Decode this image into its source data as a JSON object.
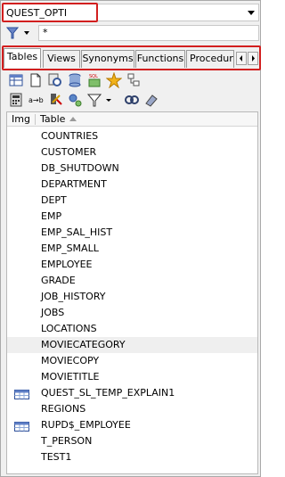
{
  "schema": {
    "value": "QUEST_OPTI"
  },
  "filter": {
    "value": "*"
  },
  "tabs": [
    {
      "label": "Tables",
      "active": true
    },
    {
      "label": "Views"
    },
    {
      "label": "Synonyms"
    },
    {
      "label": "Functions"
    },
    {
      "label": "Procedure"
    }
  ],
  "columns": {
    "img": "Img",
    "table": "Table"
  },
  "rows": [
    {
      "name": "COUNTRIES"
    },
    {
      "name": "CUSTOMER"
    },
    {
      "name": "DB_SHUTDOWN"
    },
    {
      "name": "DEPARTMENT"
    },
    {
      "name": "DEPT"
    },
    {
      "name": "EMP"
    },
    {
      "name": "EMP_SAL_HIST"
    },
    {
      "name": "EMP_SMALL"
    },
    {
      "name": "EMPLOYEE"
    },
    {
      "name": "GRADE"
    },
    {
      "name": "JOB_HISTORY"
    },
    {
      "name": "JOBS"
    },
    {
      "name": "LOCATIONS"
    },
    {
      "name": "MOVIECATEGORY",
      "selected": true
    },
    {
      "name": "MOVIECOPY"
    },
    {
      "name": "MOVIETITLE"
    },
    {
      "name": "QUEST_SL_TEMP_EXPLAIN1",
      "icon": "table-grid-icon"
    },
    {
      "name": "REGIONS"
    },
    {
      "name": "RUPD$_EMPLOYEE",
      "icon": "table-grid-icon"
    },
    {
      "name": "T_PERSON"
    },
    {
      "name": "TEST1"
    }
  ],
  "icons": {
    "toolbar1": [
      "table-view-icon",
      "new-document-icon",
      "query-icon",
      "database-sql-icon",
      "stats-chart-icon",
      "favorite-star-icon",
      "tree-icon"
    ],
    "toolbar2": [
      "calculator-icon",
      "rename-icon",
      "tools-icon",
      "gear-icon",
      "filter-icon",
      "filter-dropdown-icon",
      "link-icon",
      "eraser-icon"
    ]
  },
  "colors": {
    "highlight": "#d21f1f",
    "selected_row": "#efefef"
  }
}
